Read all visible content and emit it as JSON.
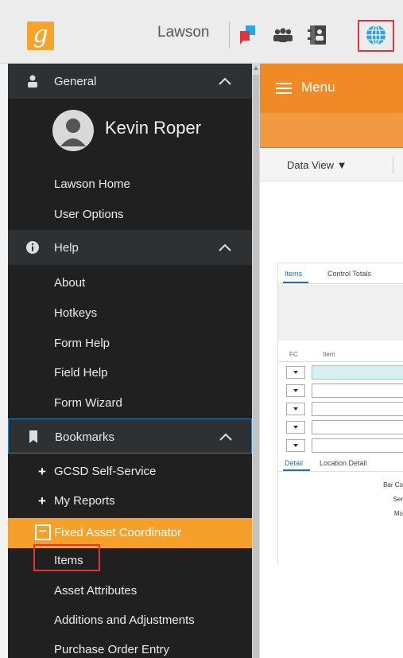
{
  "app": {
    "brand": "Lawson",
    "logo_letter": "g",
    "accent_color": "#ef8a24",
    "highlight_color": "#e0363a",
    "toolbar_icons": [
      "chat-bubbles-icon",
      "people-icon",
      "contacts-book-icon",
      "globe-icon"
    ]
  },
  "sidebar": {
    "general": {
      "label": "General",
      "user_name": "Kevin Roper",
      "items": [
        "Lawson Home",
        "User Options"
      ]
    },
    "help": {
      "label": "Help",
      "items": [
        "About",
        "Hotkeys",
        "Form Help",
        "Field Help",
        "Form Wizard"
      ]
    },
    "bookmarks": {
      "label": "Bookmarks",
      "folders": [
        {
          "label": "GCSD Self-Service",
          "toggle": "+"
        },
        {
          "label": "My Reports",
          "toggle": "+"
        }
      ],
      "active_folder": {
        "label": "Fixed Asset Coordinator",
        "toggle": "−"
      },
      "active_items": [
        "Items",
        "Asset Attributes",
        "Additions and Adjustments",
        "Purchase Order Entry"
      ]
    }
  },
  "main": {
    "menu_label": "Menu",
    "data_view_label": "Data View ▼",
    "form": {
      "tabs": [
        "Items",
        "Control Totals"
      ],
      "columns": [
        "FC",
        "Item"
      ],
      "row_count": 5,
      "detail_tabs": [
        "Detail",
        "Location Detail"
      ],
      "field_labels": [
        "Bar Co",
        "Ser",
        "Mo"
      ]
    }
  }
}
